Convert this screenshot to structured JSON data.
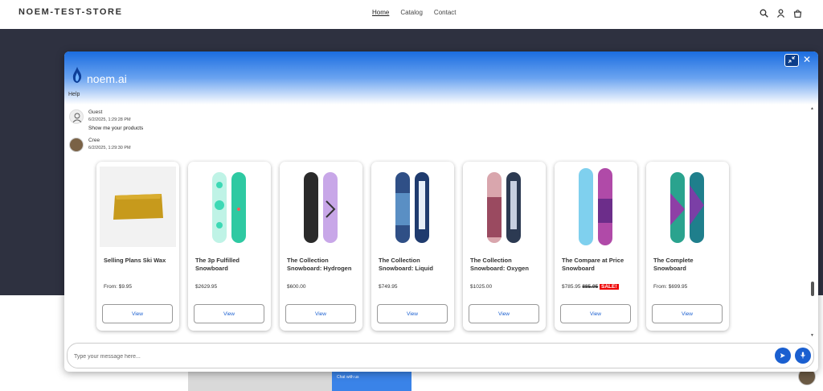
{
  "store": {
    "title": "NOEM-TEST-STORE",
    "nav": [
      "Home",
      "Catalog",
      "Contact"
    ]
  },
  "widget": {
    "brand": "noem.ai",
    "help": "Help",
    "brand_color": "#1b6de0",
    "messages": [
      {
        "name": "Guest",
        "time": "6/2/2025, 1:29:28 PM",
        "text": "Show me your products"
      },
      {
        "name": "Cree",
        "time": "6/2/2025, 1:29:30 PM",
        "text": ""
      }
    ],
    "input_placeholder": "Type your message here..."
  },
  "products": [
    {
      "title": "Selling Plans Ski Wax",
      "price": "From: $9.95",
      "button": "View"
    },
    {
      "title": "The 3p Fulfilled Snowboard",
      "price": "$2629.95",
      "button": "View"
    },
    {
      "title": "The Collection Snowboard: Hydrogen",
      "price": "$600.00",
      "button": "View"
    },
    {
      "title": "The Collection Snowboard: Liquid",
      "price": "$749.95",
      "button": "View"
    },
    {
      "title": "The Collection Snowboard: Oxygen",
      "price": "$1025.00",
      "button": "View"
    },
    {
      "title": "The Compare at Price Snowboard",
      "price": "$785.95",
      "compare_price": "885.95",
      "sale_badge": "SALE!",
      "button": "View"
    },
    {
      "title": "The Complete Snowboard",
      "price": "From: $699.95",
      "button": "View"
    }
  ],
  "background": {
    "chat_label": "Chat with us"
  }
}
